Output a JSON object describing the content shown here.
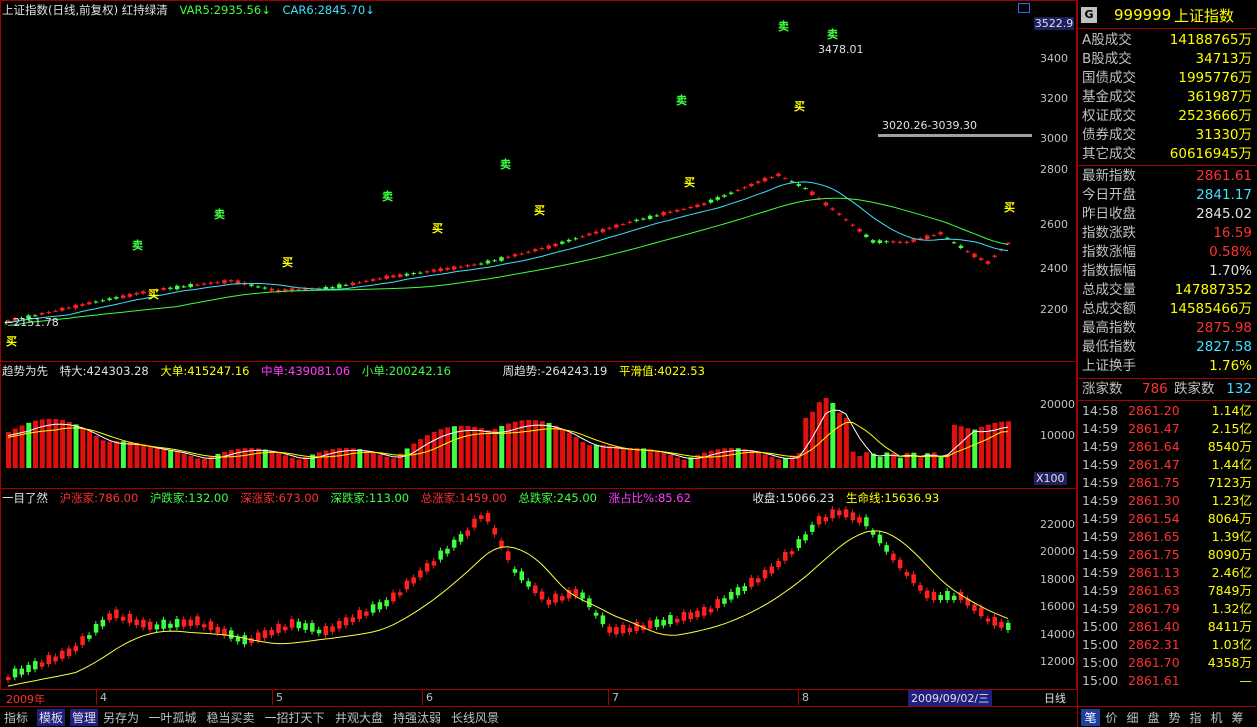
{
  "main": {
    "title": "上证指数(日线,前复权) 红持绿清",
    "var5": "VAR5:2935.56",
    "car6": "CAR6:2845.70",
    "right_top": "3522.9",
    "y_ticks": [
      "3400",
      "3200",
      "3000",
      "2800",
      "2600",
      "2400",
      "2200"
    ],
    "high_label": "3478.01",
    "low_label": "←2151.78",
    "range_label": "3020.26-3039.30",
    "buy": "买",
    "sell": "卖"
  },
  "mid": {
    "title": "趋势为先",
    "tedao": "特大:424303.28",
    "dadan": "大单:415247.16",
    "zhongdan": "中单:439081.06",
    "xiaodan": "小单:200242.16",
    "zhouqs": "周趋势:-264243.19",
    "pinghua": "平滑值:4022.53",
    "y_ticks": [
      "20000",
      "10000"
    ],
    "x100": "X100"
  },
  "low": {
    "title": "一目了然",
    "hzj": "沪涨家:786.00",
    "hdj": "沪跌家:132.00",
    "szj": "深涨家:673.00",
    "sdj": "深跌家:113.00",
    "zzj": "总涨家:1459.00",
    "zdj": "总跌家:245.00",
    "zzb": "涨占比%:85.62",
    "shoupan": "收盘:15066.23",
    "smx": "生命线:15636.93",
    "y_ticks": [
      "22000",
      "20000",
      "18000",
      "16000",
      "14000",
      "12000"
    ]
  },
  "timeline": {
    "year": "2009年",
    "months": [
      "4",
      "5",
      "6",
      "7",
      "8"
    ],
    "cursor_date": "2009/09/02/三",
    "period": "日线"
  },
  "toolbar": [
    "指标",
    "模板",
    "管理",
    "另存为",
    "一叶孤城",
    "稳当买卖",
    "一招打天下",
    "井观大盘",
    "持强汰弱",
    "长线风景"
  ],
  "right_panel": {
    "badge": "G",
    "code": "999999",
    "name": "上证指数",
    "rows1": [
      {
        "k": "A股成交",
        "v": "14188765万"
      },
      {
        "k": "B股成交",
        "v": "34713万"
      },
      {
        "k": "国债成交",
        "v": "1995776万"
      },
      {
        "k": "基金成交",
        "v": "361987万"
      },
      {
        "k": "权证成交",
        "v": "2523666万"
      },
      {
        "k": "债券成交",
        "v": "31330万"
      },
      {
        "k": "其它成交",
        "v": "60616945万"
      }
    ],
    "rows2": [
      {
        "k": "最新指数",
        "v": "2861.61",
        "c": "#ff3030"
      },
      {
        "k": "今日开盘",
        "v": "2841.17",
        "c": "#40e0ff"
      },
      {
        "k": "昨日收盘",
        "v": "2845.02",
        "c": "#e0e0e0"
      },
      {
        "k": "指数涨跌",
        "v": "16.59",
        "c": "#ff3030"
      },
      {
        "k": "指数涨幅",
        "v": "0.58%",
        "c": "#ff3030"
      },
      {
        "k": "指数振幅",
        "v": "1.70%",
        "c": "#e0e0e0"
      },
      {
        "k": "总成交量",
        "v": "147887352",
        "c": "#ffff00"
      },
      {
        "k": "总成交额",
        "v": "14585466万",
        "c": "#ffff00"
      },
      {
        "k": "最高指数",
        "v": "2875.98",
        "c": "#ff3030"
      },
      {
        "k": "最低指数",
        "v": "2827.58",
        "c": "#40e0ff"
      },
      {
        "k": "上证换手",
        "v": "1.76%",
        "c": "#ffff00"
      }
    ],
    "up_label": "涨家数",
    "up": "786",
    "down_label": "跌家数",
    "down": "132",
    "ticks": [
      {
        "t": "14:58",
        "p": "2861.20",
        "q": "1.14亿"
      },
      {
        "t": "14:59",
        "p": "2861.47",
        "q": "2.15亿"
      },
      {
        "t": "14:59",
        "p": "2861.64",
        "q": "8540万"
      },
      {
        "t": "14:59",
        "p": "2861.47",
        "q": "1.44亿"
      },
      {
        "t": "14:59",
        "p": "2861.75",
        "q": "7123万"
      },
      {
        "t": "14:59",
        "p": "2861.30",
        "q": "1.23亿"
      },
      {
        "t": "14:59",
        "p": "2861.54",
        "q": "8064万"
      },
      {
        "t": "14:59",
        "p": "2861.65",
        "q": "1.39亿"
      },
      {
        "t": "14:59",
        "p": "2861.75",
        "q": "8090万"
      },
      {
        "t": "14:59",
        "p": "2861.13",
        "q": "2.46亿"
      },
      {
        "t": "14:59",
        "p": "2861.63",
        "q": "7849万"
      },
      {
        "t": "14:59",
        "p": "2861.79",
        "q": "1.32亿"
      },
      {
        "t": "15:00",
        "p": "2861.40",
        "q": "8411万"
      },
      {
        "t": "15:00",
        "p": "2862.31",
        "q": "1.03亿"
      },
      {
        "t": "15:00",
        "p": "2861.70",
        "q": "4358万"
      },
      {
        "t": "15:00",
        "p": "2861.61",
        "q": "—"
      }
    ],
    "tabs": [
      "笔",
      "价",
      "细",
      "盘",
      "势",
      "指",
      "机",
      "筹"
    ]
  }
}
